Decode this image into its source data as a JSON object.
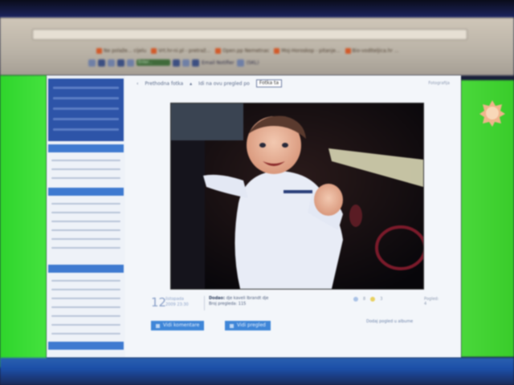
{
  "browser": {
    "bookmarks": [
      {
        "label": "Ne polaže... cijelu"
      },
      {
        "label": "Vrt.hr-ni.pl - pretraž..."
      },
      {
        "label": "Open.pp Nemetnac"
      },
      {
        "label": "Moj-Horoskop - pitanje..."
      },
      {
        "label": "Bio-voditeljica.hr ..."
      }
    ],
    "toolbar_field": "Enter...",
    "toolbar_email": "Email Notifier",
    "toolbar_extra": "(SKL)"
  },
  "content": {
    "nav_prev": "Prethodna fotka",
    "nav_label": "Idi na ovu pregled po",
    "nav_select": "Fotka ta",
    "nav_right": "Fotografija"
  },
  "photo": {
    "date_day": "12",
    "date_month": "listopada",
    "date_year": "2009 23:30",
    "author_label": "Dodao:",
    "author_name": "dje kaveli Ibrandt dje",
    "views": "Broj pregleda: 115",
    "rating_a": "8",
    "rating_b": "3",
    "more": "Pogled: 4"
  },
  "actions": {
    "btn_comment": "Vidi komentare",
    "btn_next": "Vidi pregled",
    "link_right": "Dodaj pogled u albume"
  },
  "colors": {
    "accent": "#3f86d8",
    "green": "#3fd93a"
  }
}
